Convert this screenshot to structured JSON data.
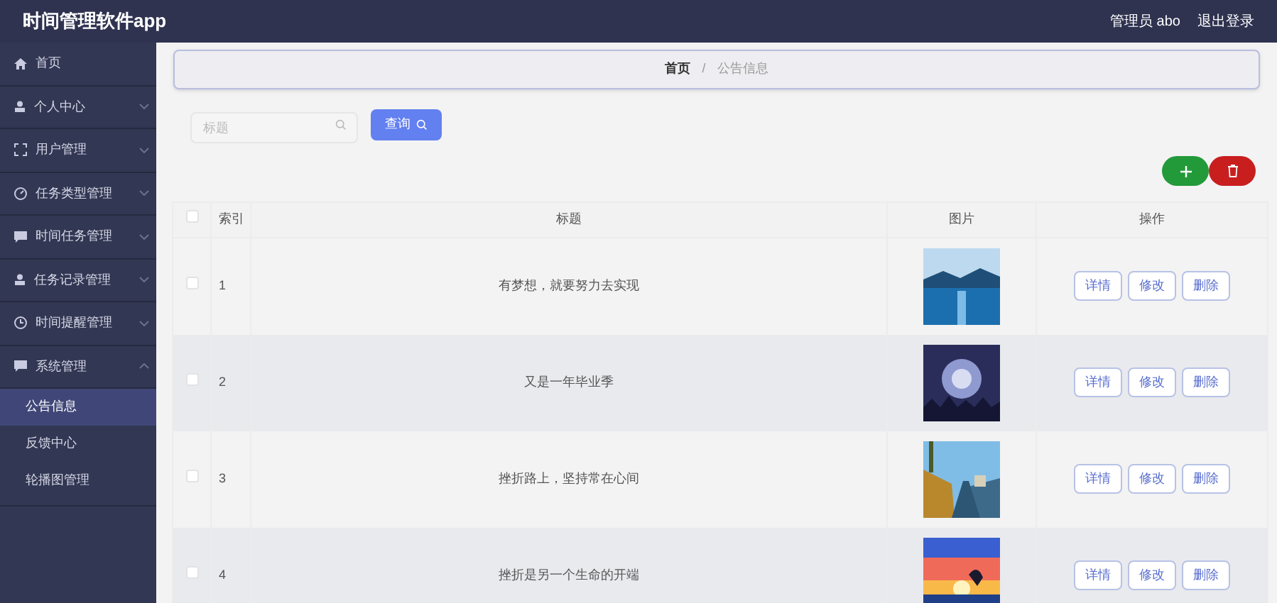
{
  "header": {
    "app_title": "时间管理软件app",
    "user": "管理员 abo",
    "logout": "退出登录"
  },
  "sidebar": {
    "items": [
      {
        "label": "首页",
        "selected": false
      },
      {
        "label": "个人中心",
        "expanded": false,
        "selected": false
      },
      {
        "label": "用户管理",
        "expanded": false,
        "selected": false
      },
      {
        "label": "任务类型管理",
        "expanded": false,
        "selected": false
      },
      {
        "label": "时间任务管理",
        "expanded": false,
        "selected": false
      },
      {
        "label": "任务记录管理",
        "expanded": false,
        "selected": false
      },
      {
        "label": "时间提醒管理",
        "expanded": false,
        "selected": false
      },
      {
        "label": "系统管理",
        "expanded": true,
        "selected": false,
        "children": [
          {
            "label": "公告信息",
            "selected": true
          },
          {
            "label": "反馈中心",
            "selected": false
          },
          {
            "label": "轮播图管理",
            "selected": false
          }
        ]
      }
    ]
  },
  "breadcrumb": {
    "items": [
      "首页",
      "公告信息"
    ],
    "separator": "/"
  },
  "search": {
    "placeholder": "标题",
    "button": "查询"
  },
  "table": {
    "header_checked": false,
    "columns": [
      "索引",
      "标题",
      "图片",
      "操作"
    ],
    "rows": [
      {
        "checked": false,
        "index": "1",
        "title": "有梦想，就要努力去实现",
        "image": {
          "kind": "picture"
        },
        "actions": [
          "详情",
          "修改",
          "删除"
        ]
      },
      {
        "checked": false,
        "index": "2",
        "title": "又是一年毕业季",
        "image": {
          "kind": "picture"
        },
        "actions": [
          "详情",
          "修改",
          "删除"
        ]
      },
      {
        "checked": false,
        "index": "3",
        "title": "挫折路上，坚持常在心间",
        "image": {
          "kind": "picture"
        },
        "actions": [
          "详情",
          "修改",
          "删除"
        ]
      },
      {
        "checked": false,
        "index": "4",
        "title": "挫折是另一个生命的开端",
        "image": {
          "kind": "picture"
        },
        "actions": [
          "详情",
          "修改",
          "删除"
        ]
      }
    ]
  }
}
